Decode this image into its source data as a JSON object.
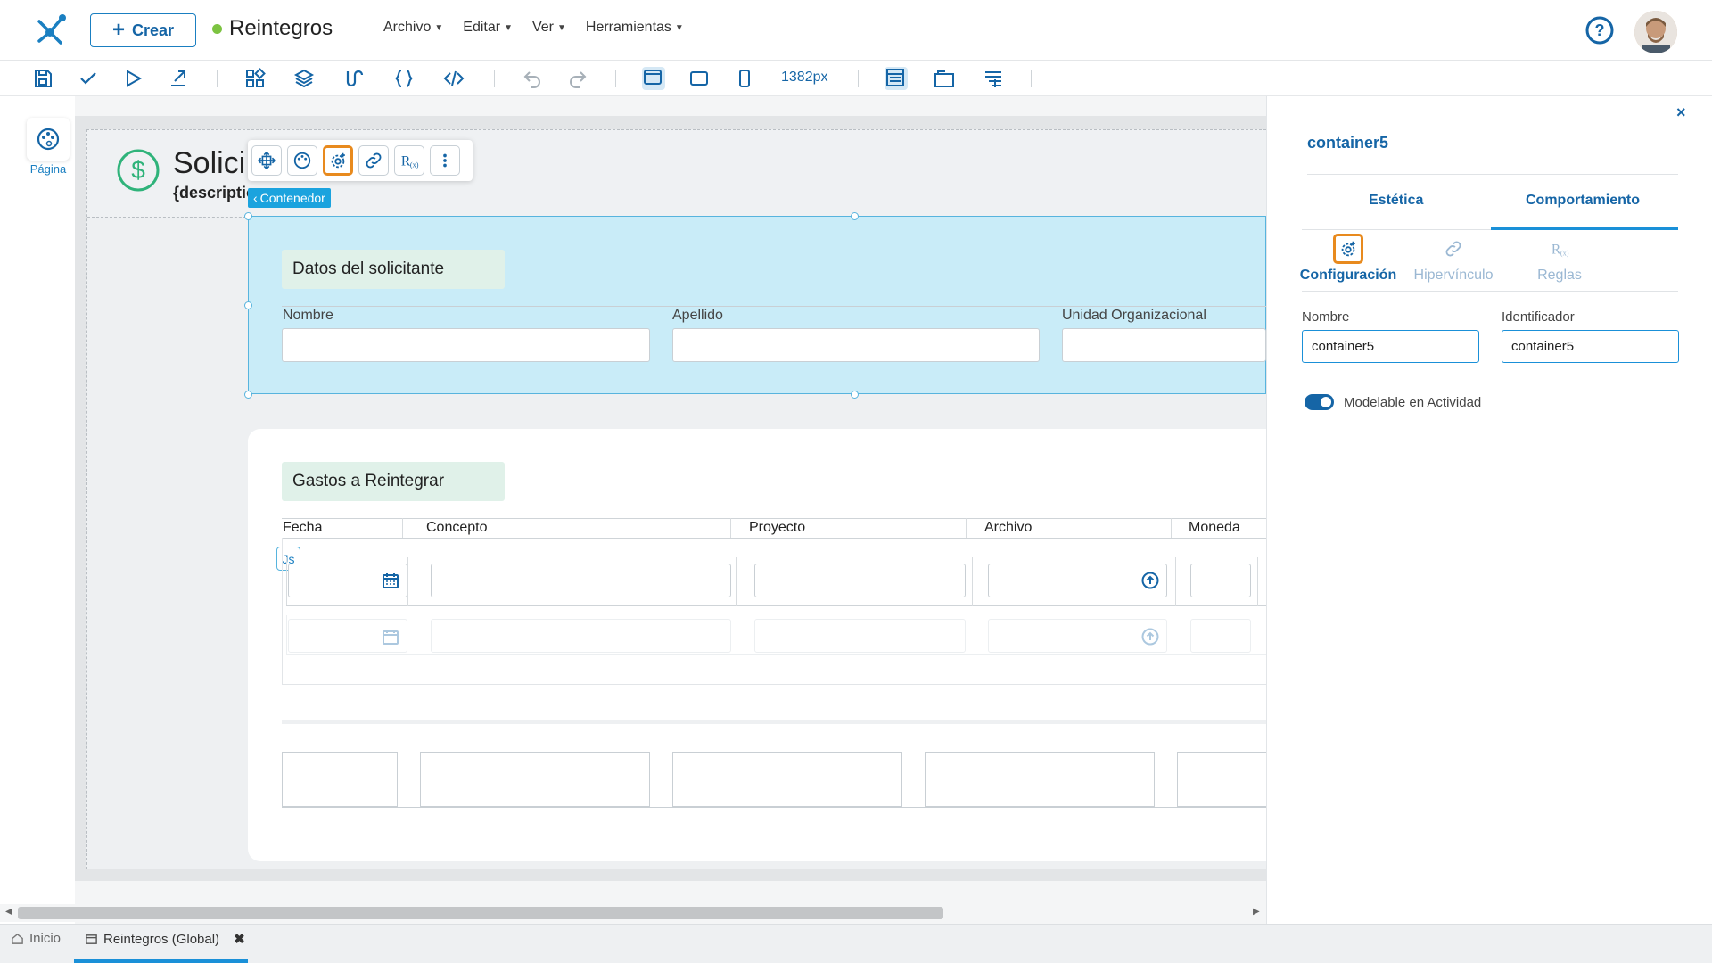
{
  "app": {
    "create_label": "Crear",
    "doc_title": "Reintegros",
    "status_color": "#7cc341",
    "menu": [
      "Archivo",
      "Editar",
      "Ver",
      "Herramientas"
    ]
  },
  "toolbar": {
    "icons": [
      "save-icon",
      "check-icon",
      "play-icon",
      "export-icon",
      "apps-icon",
      "layers-icon",
      "flow-icon",
      "braces-icon",
      "code-icon",
      "undo-icon",
      "redo-icon",
      "desktop-view-icon",
      "tablet-view-icon",
      "mobile-view-icon",
      "layout-icon",
      "window-icon",
      "align-icon"
    ],
    "width_label": "1382px"
  },
  "left_rail": {
    "page_label": "Página"
  },
  "form": {
    "title": "Solici",
    "description": "{descriptio",
    "container_tag": "Contenedor",
    "section1": {
      "label": "Datos del solicitante",
      "fields": [
        "Nombre",
        "Apellido",
        "Unidad Organizacional"
      ]
    },
    "section2": {
      "label": "Gastos a Reintegrar",
      "columns": [
        "Fecha",
        "Concepto",
        "Proyecto",
        "Archivo",
        "Moneda"
      ],
      "js_badge": "Js"
    }
  },
  "bottom_tabs": {
    "home": "Inicio",
    "current": "Reintegros (Global)"
  },
  "panel": {
    "close": "×",
    "title": "container5",
    "tabs": [
      "Estética",
      "Comportamiento"
    ],
    "subtabs": [
      "Configuración",
      "Hipervínculo",
      "Reglas"
    ],
    "name_label": "Nombre",
    "name_value": "container5",
    "id_label": "Identificador",
    "id_value": "container5",
    "toggle_label": "Modelable en Actividad",
    "toggle_on": true
  },
  "colors": {
    "accent": "#1565a6",
    "selection": "#c9ecf8",
    "highlight": "#e88a1e"
  }
}
